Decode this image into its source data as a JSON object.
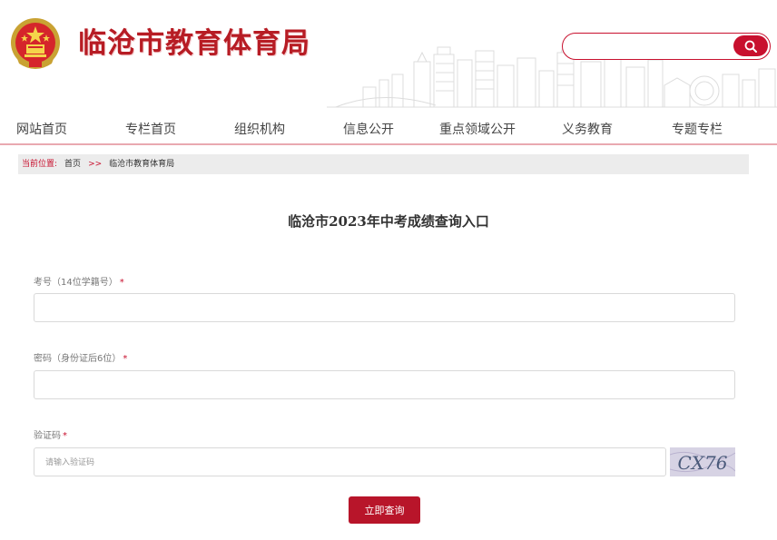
{
  "header": {
    "site_title": "临沧市教育体育局",
    "search": {
      "placeholder": "",
      "value": ""
    },
    "accent_color": "#c8102e"
  },
  "nav": {
    "items": [
      {
        "label": "网站首页"
      },
      {
        "label": "专栏首页"
      },
      {
        "label": "组织机构"
      },
      {
        "label": "信息公开"
      },
      {
        "label": "重点领域公开"
      },
      {
        "label": "义务教育"
      },
      {
        "label": "专题专栏"
      }
    ]
  },
  "breadcrumb": {
    "label": "当前位置:",
    "home": "首页",
    "separator": ">>",
    "current": "临沧市教育体育局"
  },
  "form": {
    "title": "临沧市2023年中考成绩查询入口",
    "fields": [
      {
        "label": "考号（14位学籍号）",
        "required_mark": "*",
        "value": "",
        "placeholder": ""
      },
      {
        "label": "密码（身份证后6位）",
        "required_mark": "*",
        "value": "",
        "placeholder": ""
      },
      {
        "label": "验证码",
        "required_mark": "*",
        "value": "",
        "placeholder": "请输入验证码"
      }
    ],
    "captcha_text": "CX76",
    "submit_label": "立即查询"
  },
  "icons": {
    "emblem": "national-emblem-icon",
    "search": "search-icon"
  }
}
